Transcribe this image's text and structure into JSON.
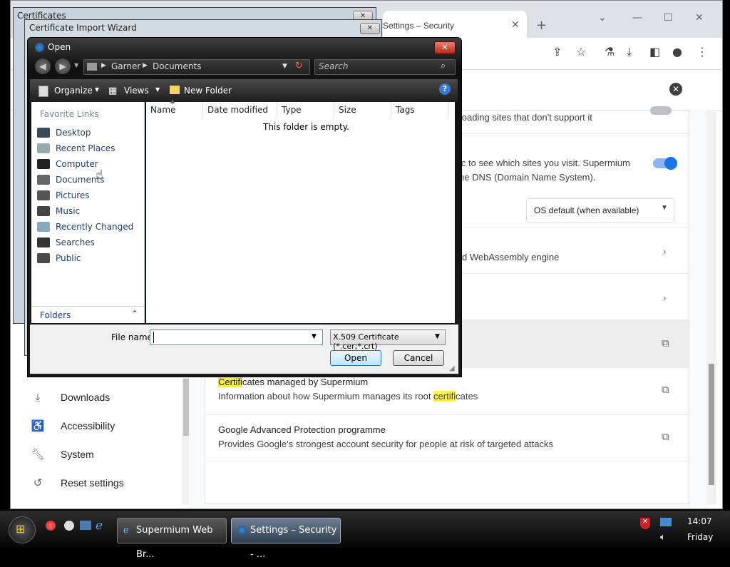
{
  "browser": {
    "tab_title": "Settings – Security",
    "sidebar": [
      {
        "icon": "download-icon",
        "label": "Downloads"
      },
      {
        "icon": "accessibility-icon",
        "label": "Accessibility"
      },
      {
        "icon": "wrench-icon",
        "label": "System"
      },
      {
        "icon": "history-icon",
        "label": "Reset settings"
      }
    ],
    "rows": {
      "https_text": "e loading sites that don't support it",
      "dns_text_1": "ic to see which sites you visit. Supermium",
      "dns_text_2": "he DNS (Domain Name System).",
      "dns_select": "OS default (when available)",
      "v8_text": "d WebAssembly engine",
      "cert_title_hl": "Certifi",
      "cert_title_rest": "cates managed by Supermium",
      "cert_sub_pre": "Information about how Supermium manages its root ",
      "cert_sub_hl": "certifi",
      "cert_sub_post": "cates",
      "gap_title": "Google Advanced Protection programme",
      "gap_sub": "Provides Google's strongest account security for people at risk of targeted attacks"
    },
    "colors": {
      "toggle": "#1a73e8",
      "highlight": "#fdef5b"
    }
  },
  "certificates_window": {
    "title": "Certificates"
  },
  "import_wizard": {
    "title": "Certificate Import Wizard"
  },
  "open_dialog": {
    "title": "Open",
    "breadcrumb": [
      "Garner",
      "Documents"
    ],
    "search_placeholder": "Search",
    "toolbar": {
      "organize": "Organize",
      "views": "Views",
      "new_folder": "New Folder"
    },
    "favorite_links_header": "Favorite Links",
    "favorite_links": [
      "Desktop",
      "Recent Places",
      "Computer",
      "Documents",
      "Pictures",
      "Music",
      "Recently Changed",
      "Searches",
      "Public"
    ],
    "folders_label": "Folders",
    "columns": [
      "Name",
      "Date modified",
      "Type",
      "Size",
      "Tags"
    ],
    "empty_message": "This folder is empty.",
    "filename_label": "File name:",
    "filename_value": "",
    "filetype": "X.509 Certificate (*.cer;*.crt)",
    "open_button": "Open",
    "cancel_button": "Cancel"
  },
  "taskbar": {
    "items": [
      "Supermium Web Br...",
      "Settings – Security - ..."
    ],
    "time": "14:07",
    "day": "Friday"
  }
}
